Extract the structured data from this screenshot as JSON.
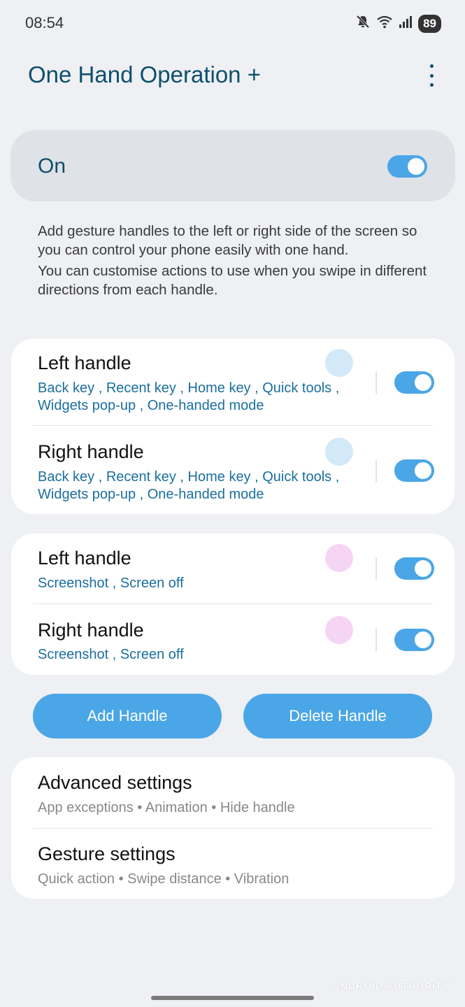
{
  "status_bar": {
    "time": "08:54",
    "battery": "89",
    "icons": [
      "mute-icon",
      "wifi-icon",
      "signal-icon"
    ]
  },
  "header": {
    "title": "One Hand Operation +",
    "menu_icon": "more-vertical-icon"
  },
  "master_switch": {
    "label": "On",
    "enabled": true
  },
  "description": {
    "line1": "Add gesture handles to the left or right side of the screen so you can control your phone easily with one hand.",
    "line2": "You can customise actions to use when you swipe in different directions from each handle."
  },
  "handle_groups": [
    {
      "items": [
        {
          "title": "Left handle",
          "subtitle": "Back key , Recent key , Home key , Quick tools , Widgets pop-up , One-handed mode",
          "enabled": true,
          "color": "#d3e9f8"
        },
        {
          "title": "Right handle",
          "subtitle": "Back key , Recent key , Home key , Quick tools , Widgets pop-up , One-handed mode",
          "enabled": true,
          "color": "#d3e9f8"
        }
      ]
    },
    {
      "items": [
        {
          "title": "Left handle",
          "subtitle": "Screenshot , Screen off",
          "enabled": true,
          "color": "#f6d4f3"
        },
        {
          "title": "Right handle",
          "subtitle": "Screenshot , Screen off",
          "enabled": true,
          "color": "#f6d4f3"
        }
      ]
    }
  ],
  "buttons": {
    "add": "Add Handle",
    "delete": "Delete Handle"
  },
  "settings": [
    {
      "title": "Advanced settings",
      "subtitle": "App exceptions • Animation • Hide handle"
    },
    {
      "title": "Gesture settings",
      "subtitle": "Quick action • Swipe distance • Vibration"
    }
  ],
  "watermark": "ANDROID AUTHORITY",
  "colors": {
    "accent": "#4aa6e6",
    "title": "#0d4f6e",
    "subtitle": "#1a6f9e",
    "background": "#eef0f3"
  }
}
